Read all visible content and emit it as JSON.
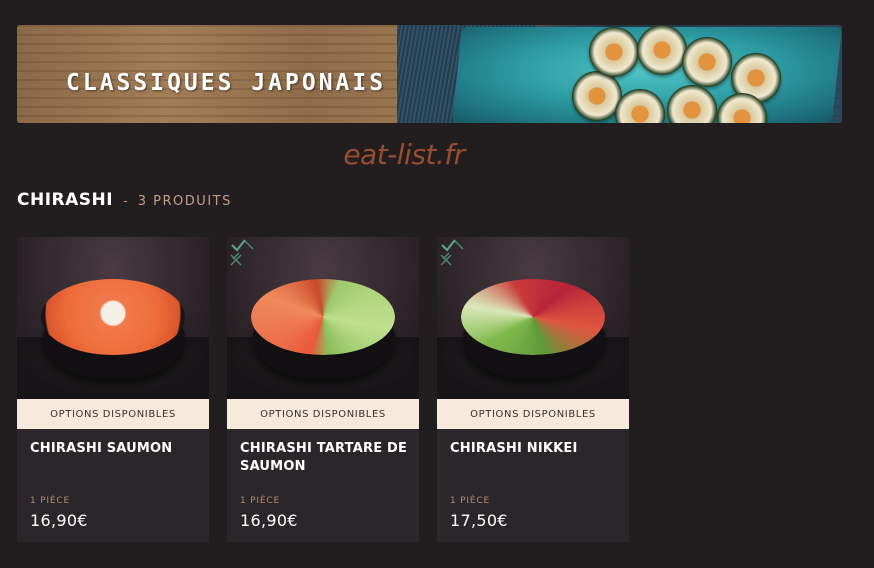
{
  "banner": {
    "title": "CLASSIQUES JAPONAIS"
  },
  "watermark": "eat-list.fr",
  "section": {
    "title": "CHIRASHI",
    "separator": "-",
    "count": "3 PRODUITS"
  },
  "products": [
    {
      "name": "CHIRASHI SAUMON",
      "options_label": "OPTIONS DISPONIBLES",
      "unit": "1 PIÈCE",
      "price": "16,90€",
      "badge_icon": ""
    },
    {
      "name": "CHIRASHI TARTARE DE SAUMON",
      "options_label": "OPTIONS DISPONIBLES",
      "unit": "1 PIÈCE",
      "price": "16,90€",
      "badge_icon": "check-pattern-icon"
    },
    {
      "name": "CHIRASHI NIKKEI",
      "options_label": "OPTIONS DISPONIBLES",
      "unit": "1 PIÈCE",
      "price": "17,50€",
      "badge_icon": "check-pattern-icon"
    }
  ],
  "colors": {
    "background": "#221e20",
    "card": "#2a2629",
    "options_bar": "#f7e9dc",
    "accent": "#b88a74",
    "watermark": "#9a4e30"
  }
}
